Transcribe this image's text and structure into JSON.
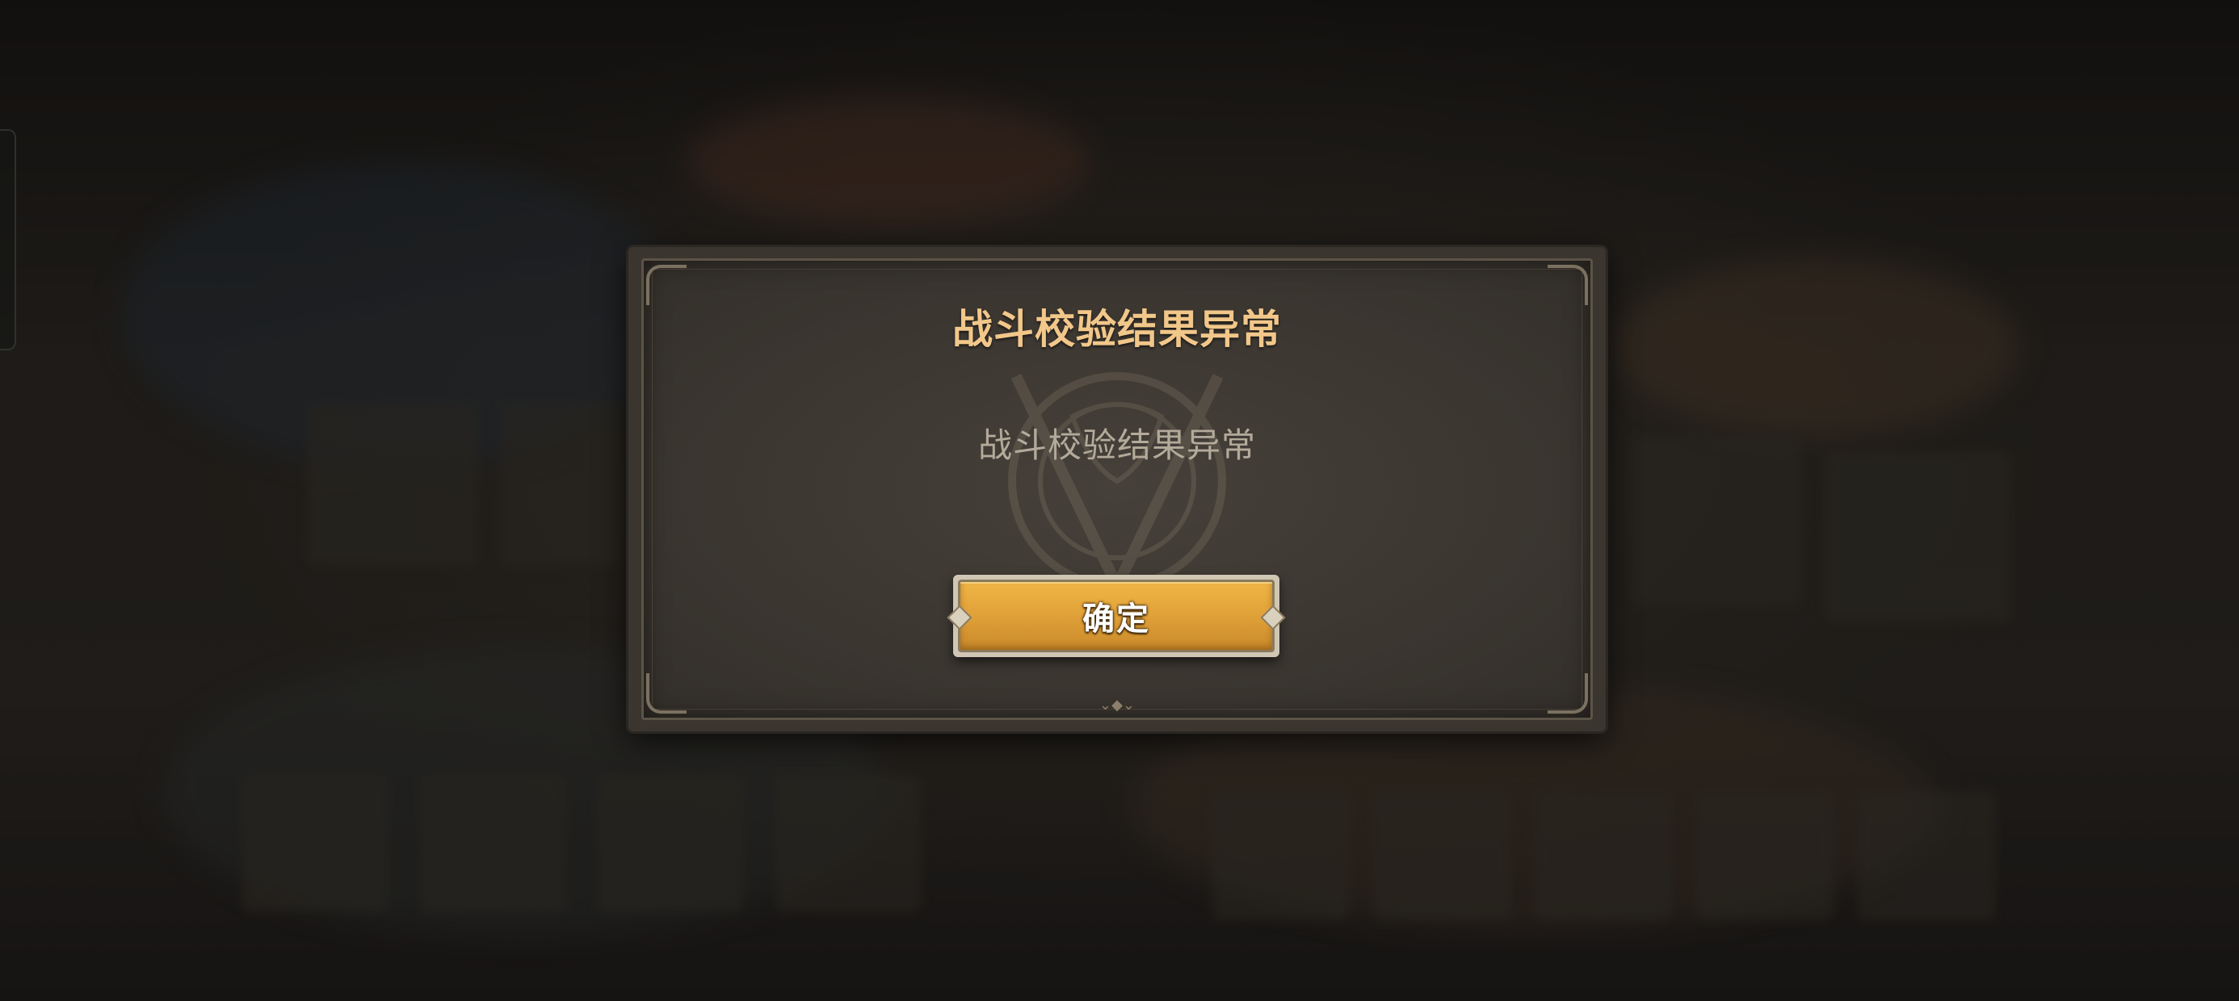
{
  "dialog": {
    "title": "战斗校验结果异常",
    "message": "战斗校验结果异常",
    "confirm_label": "确定",
    "emblem_icon": "crest-emblem-icon",
    "bottom_ornament_icon": "ornament-icon"
  },
  "colors": {
    "title": "#f2c78a",
    "message": "#b3aa9a",
    "button": "#e2a33a",
    "panel": "#3a352e"
  }
}
